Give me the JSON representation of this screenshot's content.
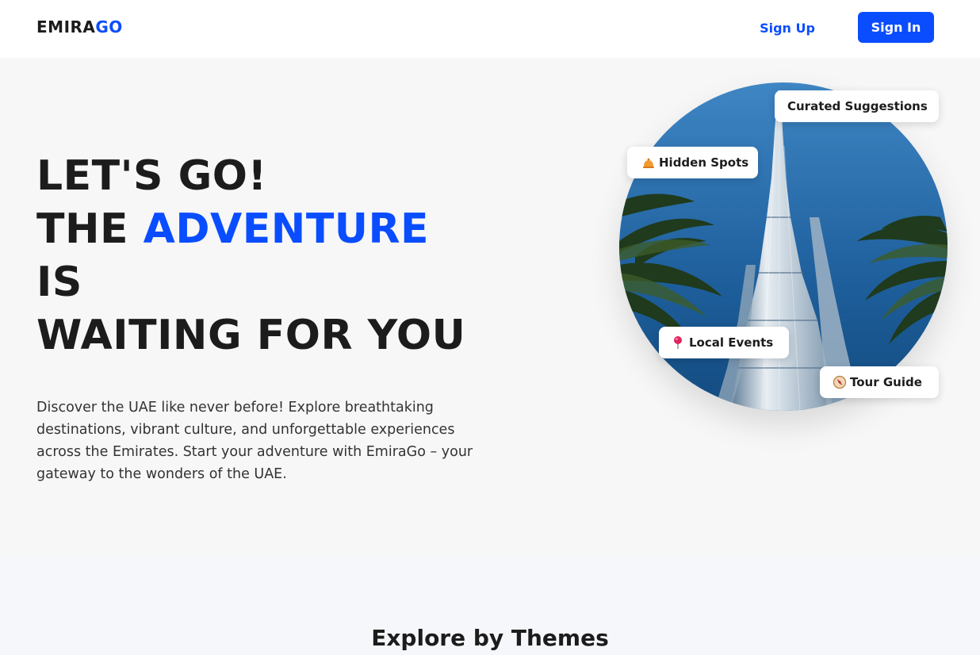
{
  "navbar": {
    "logo_main": "EMIRA",
    "logo_accent": "GO",
    "signup_label": "Sign Up",
    "signin_label": "Sign In"
  },
  "hero": {
    "title_line1": "LET'S GO!",
    "title_line2_prefix": "THE",
    "title_line2_accent": "ADVENTURE",
    "title_line3": "IS",
    "title_line4": "WAITING FOR YOU",
    "description": "Discover the UAE like never before! Explore breathtaking destinations, vibrant culture, and unforgettable experiences across the Emirates. Start your adventure with EmiraGo – your gateway to the wonders of the UAE."
  },
  "chips": {
    "curated": "Curated Suggestions",
    "hidden": "Hidden Spots",
    "hidden_icon": "bell-icon",
    "events": "Local Events",
    "events_icon": "pin-icon",
    "tour": "Tour Guide",
    "tour_icon": "compass-icon"
  },
  "themes": {
    "title": "Explore by Themes"
  },
  "colors": {
    "accent": "#0a4dff",
    "text": "#1c1c1c",
    "background": "#f7f7f7"
  }
}
